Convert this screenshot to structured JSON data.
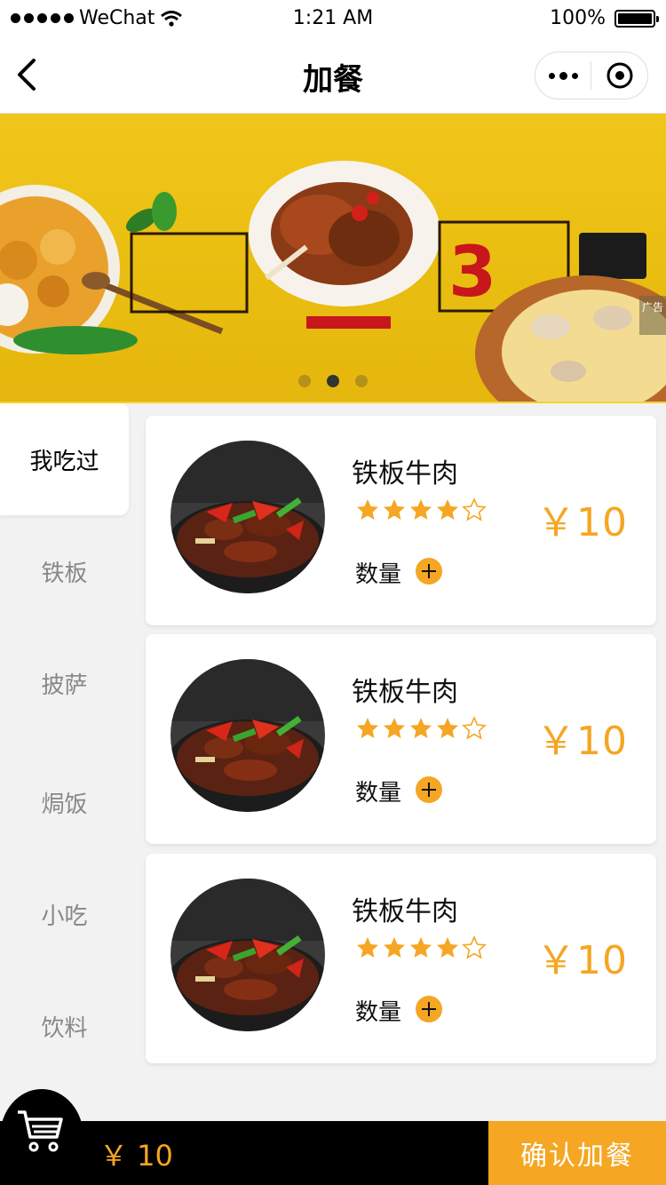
{
  "status_bar": {
    "carrier": "WeChat",
    "time": "1:21 AM",
    "battery": "100%",
    "signal_icon": "signal-dots-icon",
    "wifi_icon": "wifi-icon"
  },
  "nav": {
    "title": "加餐",
    "back_icon": "chevron-left-icon",
    "more_icon": "more-dots-icon",
    "close_icon": "target-close-icon"
  },
  "banner": {
    "ad_label": "广告",
    "slide_count": 3,
    "active_slide": 2
  },
  "sidebar": {
    "items": [
      {
        "label": "我吃过",
        "active": true
      },
      {
        "label": "铁板",
        "active": false
      },
      {
        "label": "披萨",
        "active": false
      },
      {
        "label": "焗饭",
        "active": false
      },
      {
        "label": "小吃",
        "active": false
      },
      {
        "label": "饮料",
        "active": false
      }
    ]
  },
  "foods": [
    {
      "name": "铁板牛肉",
      "rating": 4,
      "rating_max": 5,
      "price": "￥10",
      "qty_label": "数量"
    },
    {
      "name": "铁板牛肉",
      "rating": 4,
      "rating_max": 5,
      "price": "￥10",
      "qty_label": "数量"
    },
    {
      "name": "铁板牛肉",
      "rating": 4,
      "rating_max": 5,
      "price": "￥10",
      "qty_label": "数量"
    }
  ],
  "cart": {
    "icon": "shopping-cart-icon",
    "total": "￥ 10",
    "confirm_label": "确认加餐"
  },
  "colors": {
    "accent": "#f5a623",
    "banner_yellow": "#efc31a",
    "bottom_bar": "#000000"
  }
}
